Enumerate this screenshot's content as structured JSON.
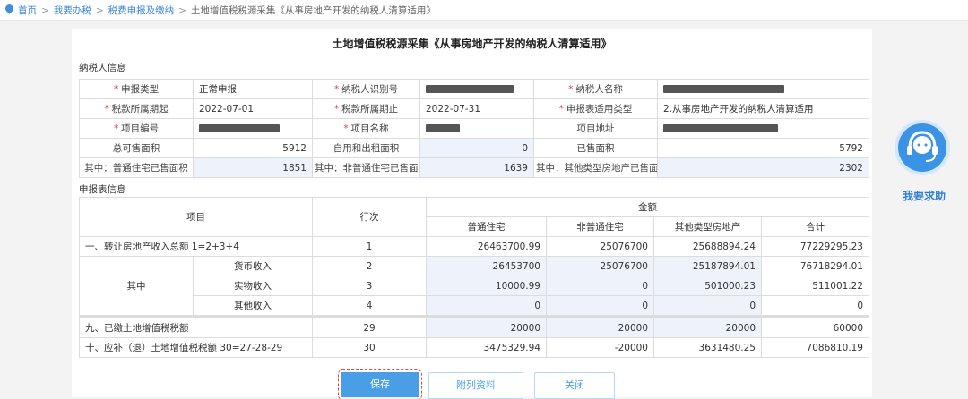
{
  "breadcrumb": {
    "home": "首页",
    "item2": "我要办税",
    "item3": "税费申报及缴纳",
    "current": "土地增值税税源采集《从事房地产开发的纳税人清算适用》"
  },
  "page_title": "土地增值税税源采集《从事房地产开发的纳税人清算适用》",
  "section_taxpayer": "纳税人信息",
  "section_report": "申报表信息",
  "fields": {
    "declare_type_label": "申报类型",
    "declare_type_value": "正常申报",
    "taxpayer_id_label": "纳税人识别号",
    "taxpayer_name_label": "纳税人名称",
    "period_start_label": "税款所属期起",
    "period_start_value": "2022-07-01",
    "period_end_label": "税款所属期止",
    "period_end_value": "2022-07-31",
    "report_type_label": "申报表适用类型",
    "report_type_value": "2.从事房地产开发的纳税人清算适用",
    "project_no_label": "项目编号",
    "project_name_label": "项目名称",
    "project_addr_label": "项目地址",
    "total_sellable_label": "总可售面积",
    "total_sellable_value": "5912",
    "self_rent_label": "自用和出租面积",
    "self_rent_value": "0",
    "sold_area_label": "已售面积",
    "sold_area_value": "5792",
    "ordinary_sold_label": "其中：普通住宅已售面积",
    "ordinary_sold_value": "1851",
    "nonordinary_sold_label": "其中：非普通住宅已售面积",
    "nonordinary_sold_value": "1639",
    "other_sold_label": "其中：其他类型房地产已售面积",
    "other_sold_value": "2302"
  },
  "report": {
    "col_item": "项目",
    "col_line": "行次",
    "col_amount": "金额",
    "col_ordinary": "普通住宅",
    "col_nonordinary": "非普通住宅",
    "col_other": "其他类型房地产",
    "col_total": "合计",
    "row1_label": "一、转让房地产收入总额 1=2+3+4",
    "row1_line": "1",
    "row1": [
      "26463700.99",
      "25076700",
      "25688894.24",
      "77229295.23"
    ],
    "among": "其中",
    "row2_label": "货币收入",
    "row2_line": "2",
    "row2": [
      "26453700",
      "25076700",
      "25187894.01",
      "76718294.01"
    ],
    "row3_label": "实物收入",
    "row3_line": "3",
    "row3": [
      "10000.99",
      "0",
      "501000.23",
      "511001.22"
    ],
    "row4_label": "其他收入",
    "row4_line": "4",
    "row4": [
      "0",
      "0",
      "0",
      "0"
    ],
    "row29_label": "九、已缴土地增值税税额",
    "row29_line": "29",
    "row29": [
      "20000",
      "20000",
      "20000",
      "60000"
    ],
    "row30_label": "十、应补（退）土地增值税税额 30=27-28-29",
    "row30_line": "30",
    "row30": [
      "3475329.94",
      "-20000",
      "3631480.25",
      "7086810.19"
    ]
  },
  "buttons": {
    "save": "保存",
    "attach": "附列资料",
    "close": "关闭"
  },
  "help_label": "我要求助",
  "colors": {
    "primary": "#4a9ee6",
    "required": "#e04444",
    "link": "#3a86d6",
    "input_bg": "#eef3fb"
  }
}
